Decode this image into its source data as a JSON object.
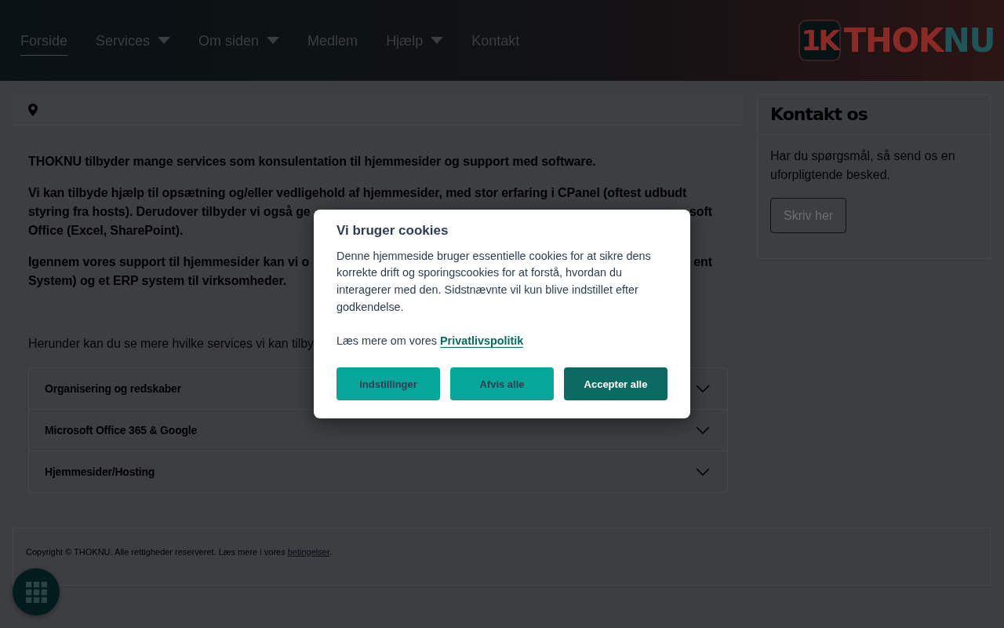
{
  "header": {
    "nav": [
      {
        "label": "Forside",
        "selected": true,
        "dropdown": false
      },
      {
        "label": "Services",
        "selected": false,
        "dropdown": true
      },
      {
        "label": "Om siden",
        "selected": false,
        "dropdown": true
      },
      {
        "label": "Medlem",
        "selected": false,
        "dropdown": false
      },
      {
        "label": "Hjælp",
        "selected": false,
        "dropdown": true
      },
      {
        "label": "Kontakt",
        "selected": false,
        "dropdown": false
      }
    ],
    "logo": {
      "badge": "1K",
      "parts": [
        {
          "text": "THOK",
          "color": "#8a2a27"
        },
        {
          "text": "NU",
          "color": "#1f5559"
        }
      ]
    }
  },
  "main": {
    "paragraphs": [
      {
        "kind": "strong",
        "lines": [
          {
            "text": "THOKNU tilbyder mange services som konsulentation til hjemmesider og support med software."
          }
        ]
      },
      {
        "kind": "strong",
        "lines": [
          {
            "text": "Vi kan tilbyde hjælp til opsætning og/eller vedligehold af hjemmesider, med stor erfaring i CPanel (oftest udbudt"
          },
          {
            "text": "styring fra hosts). Derudover tilbyder vi også ge",
            "tail": "soft"
          },
          {
            "text": "Office (Excel, SharePoint)."
          }
        ]
      },
      {
        "kind": "strong",
        "lines": [
          {
            "text": "Igennem vores support til hjemmesider kan vi o",
            "tail": "ent"
          },
          {
            "text": "System) og et ERP system til virksomheder."
          }
        ]
      },
      {
        "kind": "normal",
        "lines": [
          {
            "text": "Herunder kan du se mere hvilke services vi kan tilby"
          }
        ]
      }
    ],
    "accordion": [
      {
        "title": "Organisering og redskaber",
        "expanded": false
      },
      {
        "title": "Microsoft Office 365 & Google",
        "expanded": false
      },
      {
        "title": "Hjemmesider/Hosting",
        "expanded": false
      }
    ]
  },
  "sidebar": {
    "contact_card": {
      "title": "Kontakt os",
      "text": "Har du spørgsmål, så send os en uforpligtende besked.",
      "button": "Skriv her"
    }
  },
  "footer": {
    "text": "Copyright © THOKNU. Alle rettigheder reserveret. Læs mere i vores ",
    "link": "betingelser",
    "after": "."
  },
  "cookie_dialog": {
    "title": "Vi bruger cookies",
    "text": "Denne hjemmeside bruger essentielle cookies for at sikre dens korrekte drift og sporingscookies for at forstå, hvordan du interagerer med den. Sidstnævnte vil kun blive indstillet efter godkendelse.",
    "more_text": "Læs mere om vores ",
    "more_link": "Privatlivspolitik",
    "buttons": [
      {
        "label": "Indstillinger",
        "kind": "secondary"
      },
      {
        "label": "Afvis alle",
        "kind": "secondary"
      },
      {
        "label": "Accepter alle",
        "kind": "primary"
      }
    ]
  }
}
